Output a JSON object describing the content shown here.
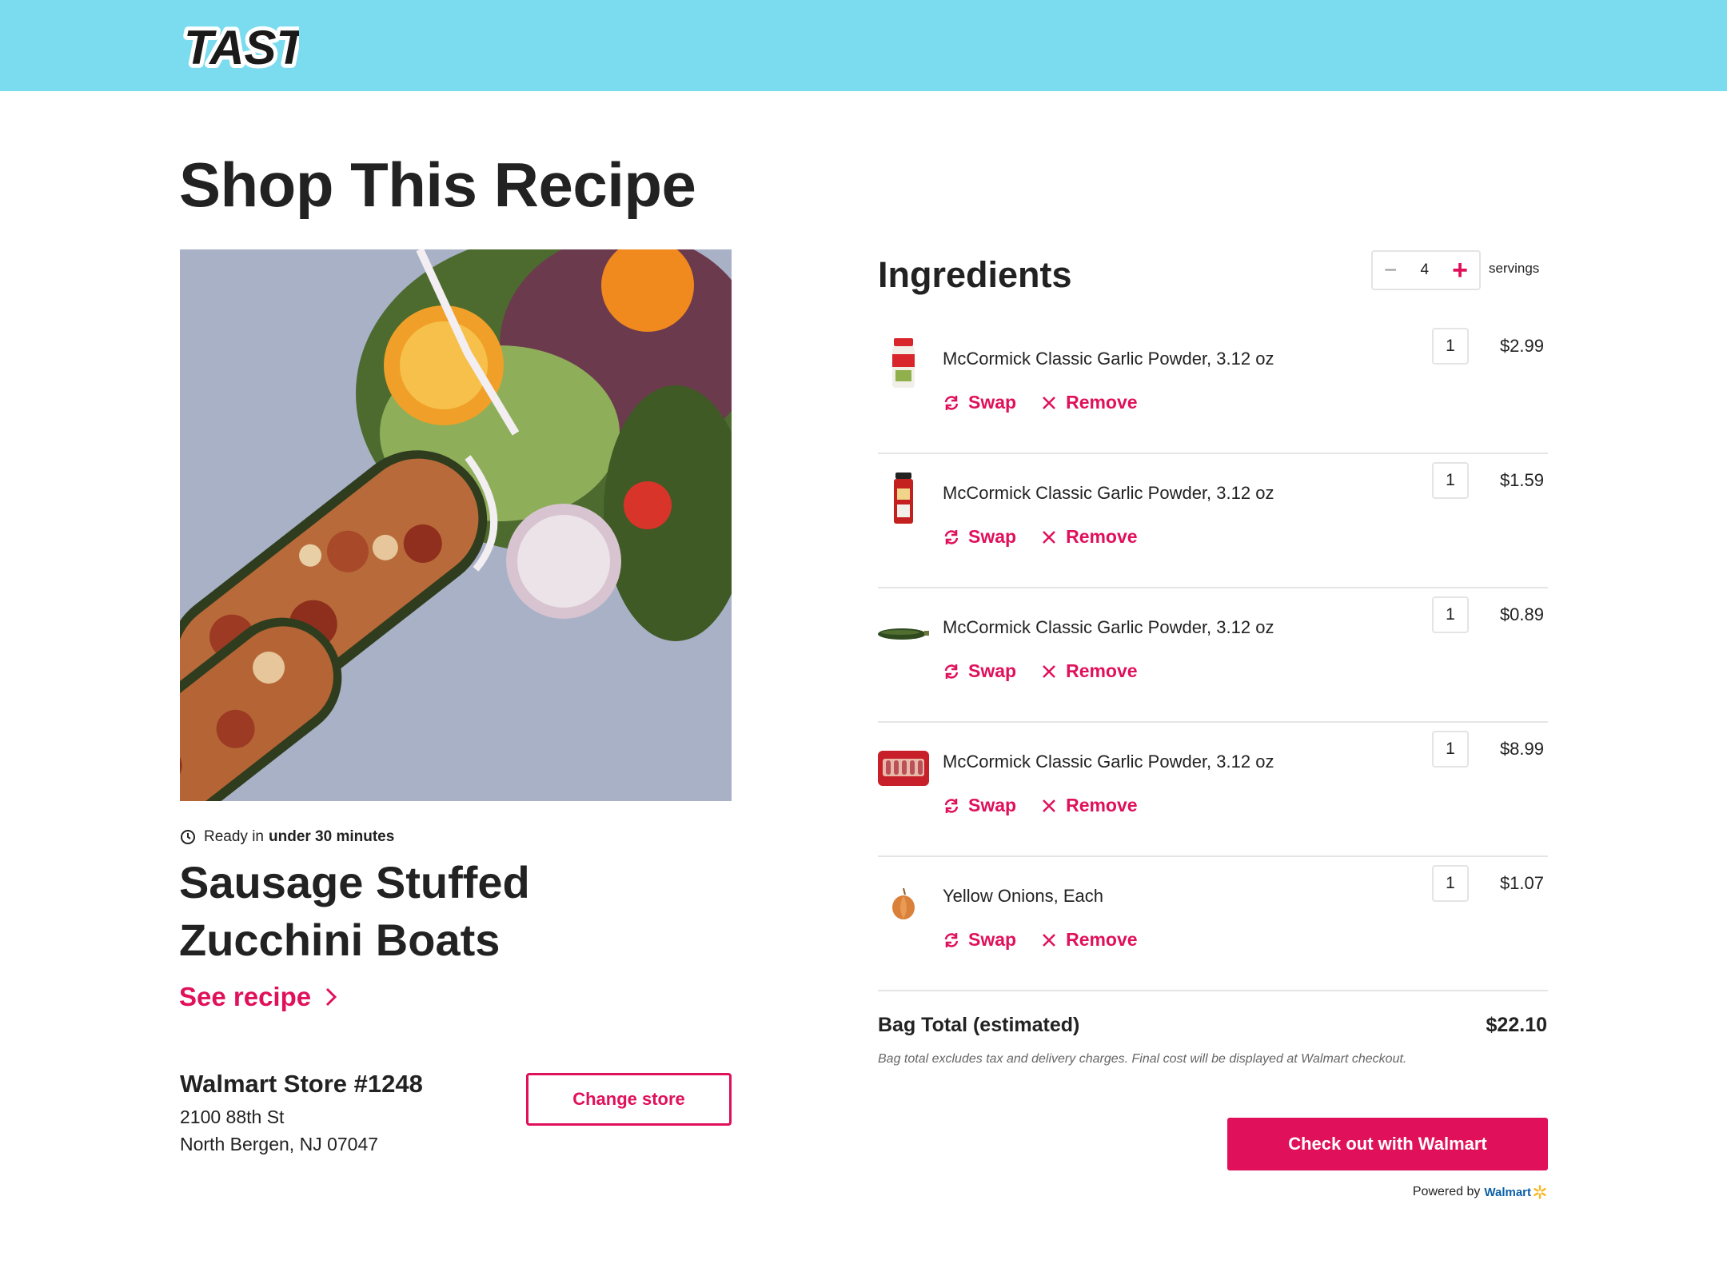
{
  "header": {
    "logo_text": "TASTY"
  },
  "page_title": "Shop This Recipe",
  "recipe": {
    "ready_prefix": "Ready in",
    "ready_time": "under 30 minutes",
    "name": "Sausage Stuffed Zucchini Boats",
    "see_recipe_label": "See recipe"
  },
  "store": {
    "name": "Walmart Store #1248",
    "address_line1": "2100 88th St",
    "address_line2": "North Bergen, NJ 07047",
    "change_label": "Change store"
  },
  "ingredients": {
    "title": "Ingredients",
    "servings_count": "4",
    "servings_label": "servings",
    "swap_label": "Swap",
    "remove_label": "Remove",
    "items": [
      {
        "name": "McCormick Classic Garlic Powder, 3.12 oz",
        "qty": "1",
        "price": "$2.99",
        "icon": "garlic-powder-jar"
      },
      {
        "name": "McCormick Classic Garlic Powder, 3.12 oz",
        "qty": "1",
        "price": "$1.59",
        "icon": "spice-jar-red"
      },
      {
        "name": "McCormick Classic Garlic Powder, 3.12 oz",
        "qty": "1",
        "price": "$0.89",
        "icon": "zucchini"
      },
      {
        "name": "McCormick Classic Garlic Powder, 3.12 oz",
        "qty": "1",
        "price": "$8.99",
        "icon": "sausage-pack"
      },
      {
        "name": "Yellow Onions, Each",
        "qty": "1",
        "price": "$1.07",
        "icon": "onion"
      }
    ]
  },
  "bag": {
    "label": "Bag Total (estimated)",
    "total": "$22.10",
    "note": "Bag total excludes tax and delivery charges. Final cost will be displayed at Walmart checkout."
  },
  "checkout": {
    "button_label": "Check out with Walmart",
    "powered_by": "Powered by",
    "partner": "Walmart"
  },
  "colors": {
    "header_bg": "#7bdcf0",
    "accent": "#e0105a",
    "walmart_blue": "#0b5ea8",
    "walmart_yellow": "#f8b61c"
  }
}
